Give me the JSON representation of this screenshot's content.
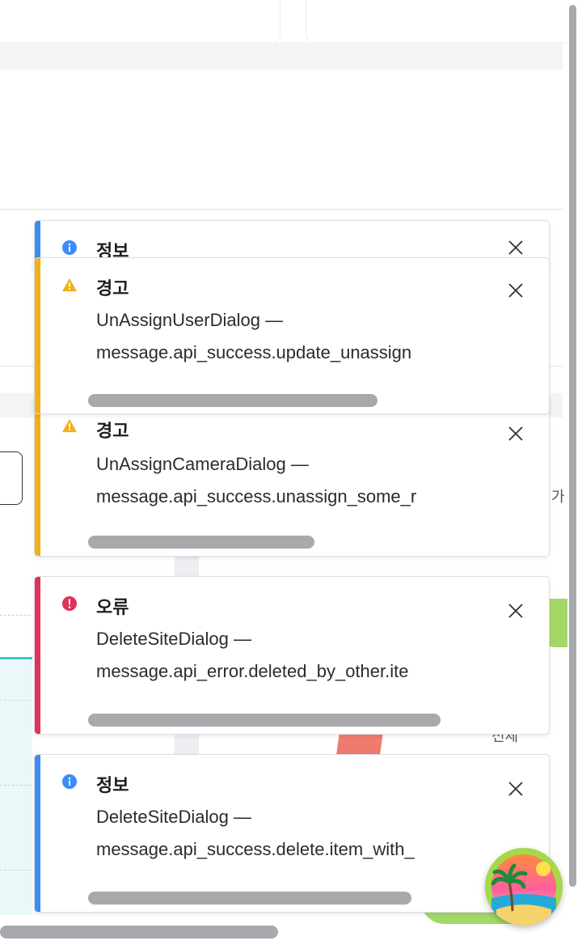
{
  "background": {
    "side_text_right": "가",
    "side_text_bottom": "전체"
  },
  "toasts": [
    {
      "type": "info",
      "title": "정보",
      "message_line1": "",
      "message_line2": "",
      "accent_color": "#3b8cf6",
      "icon": "info-icon"
    },
    {
      "type": "warning",
      "title": "경고",
      "message_line1": "UnAssignUserDialog —",
      "message_line2": "message.api_success.update_unassign",
      "accent_color": "#f0b01a",
      "icon": "warning-icon",
      "progress": 0.63
    },
    {
      "type": "warning",
      "title": "경고",
      "message_line1": "UnAssignCameraDialog —",
      "message_line2": "message.api_success.unassign_some_r",
      "accent_color": "#f0b01a",
      "icon": "warning-icon",
      "progress": 0.49
    },
    {
      "type": "error",
      "title": "오류",
      "message_line1": "DeleteSiteDialog —",
      "message_line2": "message.api_error.deleted_by_other.ite",
      "accent_color": "#e0325a",
      "icon": "error-icon",
      "progress": 0.77
    },
    {
      "type": "info",
      "title": "정보",
      "message_line1": "DeleteSiteDialog —",
      "message_line2": "message.api_success.delete.item_with_",
      "accent_color": "#3b8cf6",
      "icon": "info-icon",
      "progress": 0.7
    }
  ],
  "avatar": {
    "icon": "beach-palm-avatar-icon"
  }
}
